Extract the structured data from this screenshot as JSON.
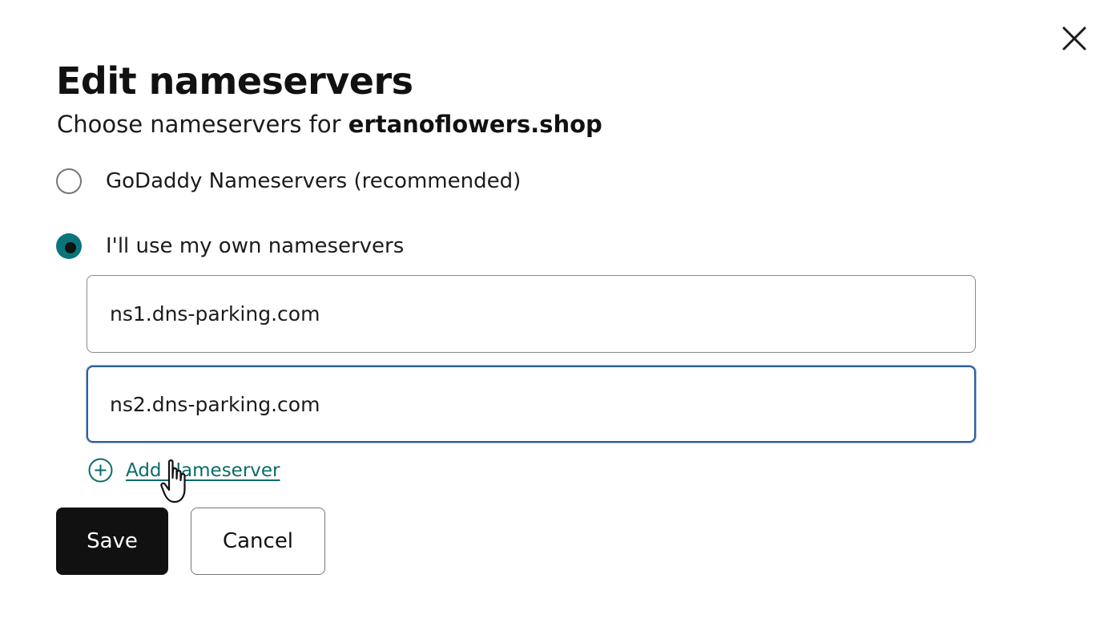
{
  "dialog": {
    "title": "Edit nameservers",
    "subtitle_prefix": "Choose nameservers for ",
    "domain": "ertanoflowers.shop",
    "close_icon": "close-icon"
  },
  "options": {
    "godaddy_label": "GoDaddy Nameservers (recommended)",
    "godaddy_selected": false,
    "own_label": "I'll use my own nameservers",
    "own_selected": true
  },
  "nameservers": {
    "ns1": "ns1.dns-parking.com",
    "ns2": "ns2.dns-parking.com"
  },
  "add_nameserver": {
    "label": "Add Nameserver",
    "icon": "plus-circle-icon"
  },
  "actions": {
    "save_label": "Save",
    "cancel_label": "Cancel"
  },
  "colors": {
    "accent": "#09757a",
    "link": "#0b6b68",
    "focus_border": "#2e5f9a",
    "primary_button": "#111111"
  },
  "cursor": "pointer-hand-icon"
}
